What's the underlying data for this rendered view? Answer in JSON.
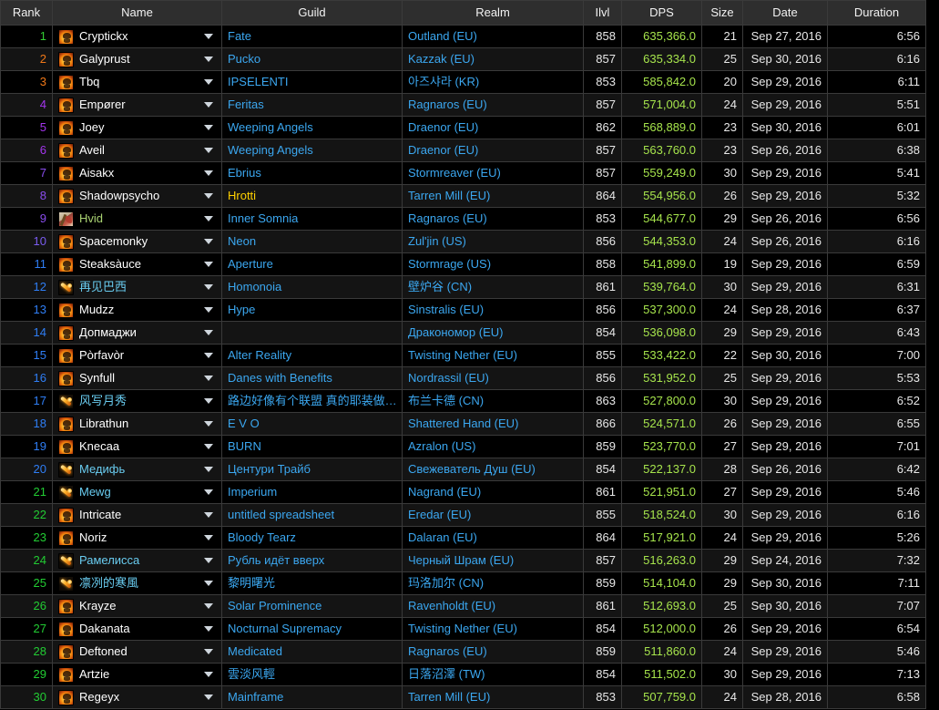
{
  "table": {
    "columns": [
      {
        "key": "rank",
        "label": "Rank"
      },
      {
        "key": "name",
        "label": "Name"
      },
      {
        "key": "guild",
        "label": "Guild"
      },
      {
        "key": "realm",
        "label": "Realm"
      },
      {
        "key": "ilvl",
        "label": "Ilvl"
      },
      {
        "key": "dps",
        "label": "DPS"
      },
      {
        "key": "size",
        "label": "Size"
      },
      {
        "key": "date",
        "label": "Date"
      },
      {
        "key": "duration",
        "label": "Duration"
      }
    ],
    "colors": {
      "link_blue": "#3ba7f0",
      "dps_green": "#a6e44c",
      "warlock_name": "#ffffff",
      "mage_name": "#69ccf0",
      "hunter_name": "#aad372",
      "guild_yellow": "#ffd100",
      "header_bg": "#2e2e2e",
      "row_bg_odd": "#000000",
      "row_bg_even": "#141414",
      "border": "#3a3a3a"
    },
    "rows": [
      {
        "rank": "1",
        "rank_color": "#33cc33",
        "icon": "warlock-fire-skull-icon",
        "name": "Cryptickx",
        "name_color": "#ffffff",
        "guild": "Fate",
        "guild_color": "#3ba7f0",
        "realm": "Outland (EU)",
        "ilvl": "858",
        "dps": "635,366.0",
        "size": "21",
        "date": "Sep 27, 2016",
        "duration": "6:56"
      },
      {
        "rank": "2",
        "rank_color": "#f07818",
        "icon": "warlock-fire-skull-icon",
        "name": "Galyprust",
        "name_color": "#ffffff",
        "guild": "Pucko",
        "guild_color": "#3ba7f0",
        "realm": "Kazzak (EU)",
        "ilvl": "857",
        "dps": "635,334.0",
        "size": "25",
        "date": "Sep 30, 2016",
        "duration": "6:16"
      },
      {
        "rank": "3",
        "rank_color": "#f07818",
        "icon": "warlock-fire-skull-icon",
        "name": "Tbq",
        "name_color": "#ffffff",
        "guild": "IPSELENTI",
        "guild_color": "#3ba7f0",
        "realm": "아즈샤라 (KR)",
        "ilvl": "853",
        "dps": "585,842.0",
        "size": "20",
        "date": "Sep 29, 2016",
        "duration": "6:11"
      },
      {
        "rank": "4",
        "rank_color": "#a335ee",
        "icon": "warlock-fire-skull-icon",
        "name": "Empører",
        "name_color": "#ffffff",
        "guild": "Feritas",
        "guild_color": "#3ba7f0",
        "realm": "Ragnaros (EU)",
        "ilvl": "857",
        "dps": "571,004.0",
        "size": "24",
        "date": "Sep 29, 2016",
        "duration": "5:51"
      },
      {
        "rank": "5",
        "rank_color": "#a335ee",
        "icon": "warlock-fire-skull-icon",
        "name": "Joey",
        "name_color": "#ffffff",
        "guild": "Weeping Angels",
        "guild_color": "#3ba7f0",
        "realm": "Draenor (EU)",
        "ilvl": "862",
        "dps": "568,889.0",
        "size": "23",
        "date": "Sep 30, 2016",
        "duration": "6:01"
      },
      {
        "rank": "6",
        "rank_color": "#a335ee",
        "icon": "warlock-fire-skull-icon",
        "name": "Aveil",
        "name_color": "#ffffff",
        "guild": "Weeping Angels",
        "guild_color": "#3ba7f0",
        "realm": "Draenor (EU)",
        "ilvl": "857",
        "dps": "563,760.0",
        "size": "23",
        "date": "Sep 26, 2016",
        "duration": "6:38"
      },
      {
        "rank": "7",
        "rank_color": "#8a4dee",
        "icon": "warlock-fire-skull-icon",
        "name": "Aisakx",
        "name_color": "#ffffff",
        "guild": "Ebrius",
        "guild_color": "#3ba7f0",
        "realm": "Stormreaver (EU)",
        "ilvl": "857",
        "dps": "559,249.0",
        "size": "30",
        "date": "Sep 29, 2016",
        "duration": "5:41"
      },
      {
        "rank": "8",
        "rank_color": "#8a4dee",
        "icon": "warlock-fire-skull-icon",
        "name": "Shadowpsycho",
        "name_color": "#ffffff",
        "guild": "Hrotti",
        "guild_color": "#ffd100",
        "realm": "Tarren Mill (EU)",
        "ilvl": "864",
        "dps": "554,956.0",
        "size": "26",
        "date": "Sep 29, 2016",
        "duration": "5:32"
      },
      {
        "rank": "9",
        "rank_color": "#8a4dee",
        "icon": "hunter-icon",
        "name": "Hvid",
        "name_color": "#aad372",
        "guild": "Inner Somnia",
        "guild_color": "#3ba7f0",
        "realm": "Ragnaros (EU)",
        "ilvl": "853",
        "dps": "544,677.0",
        "size": "29",
        "date": "Sep 26, 2016",
        "duration": "6:56"
      },
      {
        "rank": "10",
        "rank_color": "#7a5cf0",
        "icon": "warlock-fire-skull-icon",
        "name": "Spacemonky",
        "name_color": "#ffffff",
        "guild": "Neon",
        "guild_color": "#3ba7f0",
        "realm": "Zul'jin (US)",
        "ilvl": "856",
        "dps": "544,353.0",
        "size": "24",
        "date": "Sep 26, 2016",
        "duration": "6:16"
      },
      {
        "rank": "11",
        "rank_color": "#2f7ef5",
        "icon": "warlock-fire-skull-icon",
        "name": "Steaksàuce",
        "name_color": "#ffffff",
        "guild": "Aperture",
        "guild_color": "#3ba7f0",
        "realm": "Stormrage (US)",
        "ilvl": "858",
        "dps": "541,899.0",
        "size": "19",
        "date": "Sep 29, 2016",
        "duration": "6:59"
      },
      {
        "rank": "12",
        "rank_color": "#2f7ef5",
        "icon": "mage-fire-bolt-icon",
        "name": "再见巴西",
        "name_color": "#69ccf0",
        "guild": "Homonoia",
        "guild_color": "#3ba7f0",
        "realm": "壁炉谷 (CN)",
        "ilvl": "861",
        "dps": "539,764.0",
        "size": "30",
        "date": "Sep 29, 2016",
        "duration": "6:31"
      },
      {
        "rank": "13",
        "rank_color": "#2f7ef5",
        "icon": "warlock-fire-skull-icon",
        "name": "Mudzz",
        "name_color": "#ffffff",
        "guild": "Hype",
        "guild_color": "#3ba7f0",
        "realm": "Sinstralis (EU)",
        "ilvl": "856",
        "dps": "537,300.0",
        "size": "24",
        "date": "Sep 28, 2016",
        "duration": "6:37"
      },
      {
        "rank": "14",
        "rank_color": "#2f7ef5",
        "icon": "warlock-fire-skull-icon",
        "name": "Допмаджи",
        "name_color": "#ffffff",
        "guild": "",
        "guild_color": "#3ba7f0",
        "realm": "Дракономор (EU)",
        "ilvl": "854",
        "dps": "536,098.0",
        "size": "29",
        "date": "Sep 29, 2016",
        "duration": "6:43"
      },
      {
        "rank": "15",
        "rank_color": "#2f7ef5",
        "icon": "warlock-fire-skull-icon",
        "name": "Pòrfavòr",
        "name_color": "#ffffff",
        "guild": "Alter Reality",
        "guild_color": "#3ba7f0",
        "realm": "Twisting Nether (EU)",
        "ilvl": "855",
        "dps": "533,422.0",
        "size": "22",
        "date": "Sep 30, 2016",
        "duration": "7:00"
      },
      {
        "rank": "16",
        "rank_color": "#2f7ef5",
        "icon": "warlock-fire-skull-icon",
        "name": "Synfull",
        "name_color": "#ffffff",
        "guild": "Danes with Benefits",
        "guild_color": "#3ba7f0",
        "realm": "Nordrassil (EU)",
        "ilvl": "856",
        "dps": "531,952.0",
        "size": "25",
        "date": "Sep 29, 2016",
        "duration": "5:53"
      },
      {
        "rank": "17",
        "rank_color": "#2f7ef5",
        "icon": "mage-fire-bolt-icon",
        "name": "风写月秀",
        "name_color": "#69ccf0",
        "guild": "路边好像有个联盟 真的耶装做…",
        "guild_color": "#3ba7f0",
        "realm": "布兰卡德 (CN)",
        "ilvl": "863",
        "dps": "527,800.0",
        "size": "30",
        "date": "Sep 29, 2016",
        "duration": "6:52"
      },
      {
        "rank": "18",
        "rank_color": "#2f7ef5",
        "icon": "warlock-fire-skull-icon",
        "name": "Librathun",
        "name_color": "#ffffff",
        "guild": "E V O",
        "guild_color": "#3ba7f0",
        "realm": "Shattered Hand (EU)",
        "ilvl": "866",
        "dps": "524,571.0",
        "size": "26",
        "date": "Sep 29, 2016",
        "duration": "6:55"
      },
      {
        "rank": "19",
        "rank_color": "#2f7ef5",
        "icon": "warlock-fire-skull-icon",
        "name": "Knecaa",
        "name_color": "#ffffff",
        "guild": "BURN",
        "guild_color": "#3ba7f0",
        "realm": "Azralon (US)",
        "ilvl": "859",
        "dps": "523,770.0",
        "size": "27",
        "date": "Sep 29, 2016",
        "duration": "7:01"
      },
      {
        "rank": "20",
        "rank_color": "#2f7ef5",
        "icon": "mage-fire-bolt-icon",
        "name": "Медифь",
        "name_color": "#69ccf0",
        "guild": "Центури Трайб",
        "guild_color": "#3ba7f0",
        "realm": "Свежеватель Душ (EU)",
        "ilvl": "854",
        "dps": "522,137.0",
        "size": "28",
        "date": "Sep 26, 2016",
        "duration": "6:42"
      },
      {
        "rank": "21",
        "rank_color": "#22cc33",
        "icon": "mage-fire-bolt-icon",
        "name": "Mewg",
        "name_color": "#69ccf0",
        "guild": "Imperium",
        "guild_color": "#3ba7f0",
        "realm": "Nagrand (EU)",
        "ilvl": "861",
        "dps": "521,951.0",
        "size": "27",
        "date": "Sep 29, 2016",
        "duration": "5:46"
      },
      {
        "rank": "22",
        "rank_color": "#22cc33",
        "icon": "warlock-fire-skull-icon",
        "name": "Intricate",
        "name_color": "#ffffff",
        "guild": "untitled spreadsheet",
        "guild_color": "#3ba7f0",
        "realm": "Eredar (EU)",
        "ilvl": "855",
        "dps": "518,524.0",
        "size": "30",
        "date": "Sep 29, 2016",
        "duration": "6:16"
      },
      {
        "rank": "23",
        "rank_color": "#22cc33",
        "icon": "warlock-fire-skull-icon",
        "name": "Noriz",
        "name_color": "#ffffff",
        "guild": "Bloody Tearz",
        "guild_color": "#3ba7f0",
        "realm": "Dalaran (EU)",
        "ilvl": "864",
        "dps": "517,921.0",
        "size": "24",
        "date": "Sep 29, 2016",
        "duration": "5:26"
      },
      {
        "rank": "24",
        "rank_color": "#22cc33",
        "icon": "mage-fire-bolt-icon",
        "name": "Рамелисса",
        "name_color": "#69ccf0",
        "guild": "Рубль идёт вверх",
        "guild_color": "#3ba7f0",
        "realm": "Черный Шрам (EU)",
        "ilvl": "857",
        "dps": "516,263.0",
        "size": "29",
        "date": "Sep 24, 2016",
        "duration": "7:32"
      },
      {
        "rank": "25",
        "rank_color": "#22cc33",
        "icon": "mage-fire-bolt-icon",
        "name": "凛冽的寒風",
        "name_color": "#69ccf0",
        "guild": "黎明曙光",
        "guild_color": "#3ba7f0",
        "realm": "玛洛加尔 (CN)",
        "ilvl": "859",
        "dps": "514,104.0",
        "size": "29",
        "date": "Sep 30, 2016",
        "duration": "7:11"
      },
      {
        "rank": "26",
        "rank_color": "#22cc33",
        "icon": "warlock-fire-skull-icon",
        "name": "Krayze",
        "name_color": "#ffffff",
        "guild": "Solar Prominence",
        "guild_color": "#3ba7f0",
        "realm": "Ravenholdt (EU)",
        "ilvl": "861",
        "dps": "512,693.0",
        "size": "25",
        "date": "Sep 30, 2016",
        "duration": "7:07"
      },
      {
        "rank": "27",
        "rank_color": "#22cc33",
        "icon": "warlock-fire-skull-icon",
        "name": "Dakanata",
        "name_color": "#ffffff",
        "guild": "Nocturnal Supremacy",
        "guild_color": "#3ba7f0",
        "realm": "Twisting Nether (EU)",
        "ilvl": "854",
        "dps": "512,000.0",
        "size": "26",
        "date": "Sep 29, 2016",
        "duration": "6:54"
      },
      {
        "rank": "28",
        "rank_color": "#22cc33",
        "icon": "warlock-fire-skull-icon",
        "name": "Deftoned",
        "name_color": "#ffffff",
        "guild": "Medicated",
        "guild_color": "#3ba7f0",
        "realm": "Ragnaros (EU)",
        "ilvl": "859",
        "dps": "511,860.0",
        "size": "24",
        "date": "Sep 29, 2016",
        "duration": "5:46"
      },
      {
        "rank": "29",
        "rank_color": "#22cc33",
        "icon": "warlock-fire-skull-icon",
        "name": "Artzie",
        "name_color": "#ffffff",
        "guild": "雲淡风輕",
        "guild_color": "#3ba7f0",
        "realm": "日落沼澤 (TW)",
        "ilvl": "854",
        "dps": "511,502.0",
        "size": "30",
        "date": "Sep 29, 2016",
        "duration": "7:13"
      },
      {
        "rank": "30",
        "rank_color": "#22cc33",
        "icon": "warlock-fire-skull-icon",
        "name": "Regeyx",
        "name_color": "#ffffff",
        "guild": "Mainframe",
        "guild_color": "#3ba7f0",
        "realm": "Tarren Mill (EU)",
        "ilvl": "853",
        "dps": "507,759.0",
        "size": "24",
        "date": "Sep 28, 2016",
        "duration": "6:58"
      }
    ]
  }
}
